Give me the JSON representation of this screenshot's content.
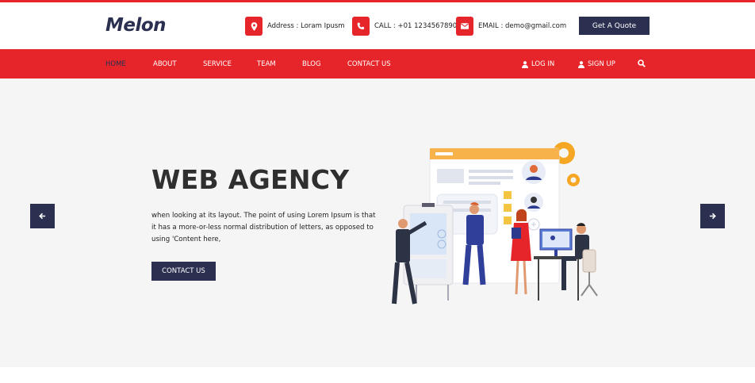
{
  "brand": {
    "logo": "Melon"
  },
  "header": {
    "contacts": [
      {
        "icon": "map-pin-icon",
        "text": "Address : Loram Ipusm"
      },
      {
        "icon": "phone-icon",
        "text": "CALL : +01 1234567890"
      },
      {
        "icon": "envelope-icon",
        "text": "EMAIL : demo@gmail.com"
      }
    ],
    "quote_label": "Get A Quote"
  },
  "nav": {
    "items": [
      "HOME",
      "ABOUT",
      "SERVICE",
      "TEAM",
      "BLOG",
      "CONTACT US"
    ],
    "active": "HOME",
    "login_label": "LOG IN",
    "signup_label": "SIGN UP",
    "search_icon": "search-icon"
  },
  "hero": {
    "title": "WEB AGENCY",
    "text": "when looking at its layout. The point of using Lorem Ipsum is that it has a more-or-less normal distribution of letters, as opposed to using 'Content here,",
    "button_label": "CONTACT US",
    "prev_icon": "arrow-left-icon",
    "next_icon": "arrow-right-icon"
  },
  "colors": {
    "accent": "#e5252a",
    "navy": "#2b3050",
    "hero_bg": "#f5f5f5"
  }
}
